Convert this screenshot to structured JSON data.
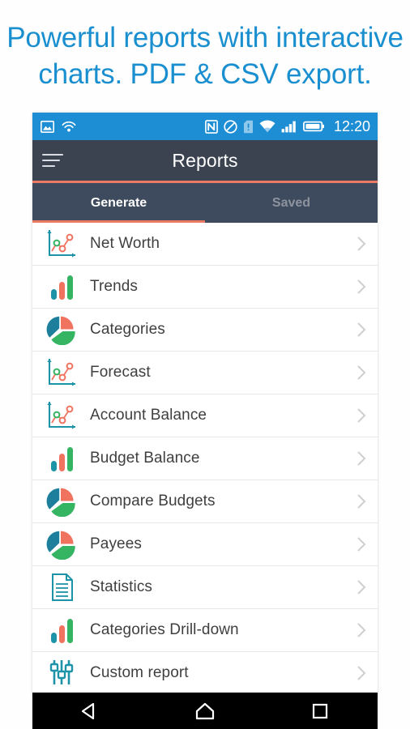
{
  "headline": {
    "line1": "Powerful reports with interactive",
    "line2": "charts. PDF & CSV export."
  },
  "colors": {
    "headline": "#1a8fd0",
    "status_bar": "#1e8ed4",
    "toolbar": "#3b4350",
    "tabbar": "#3e4a5e",
    "accent": "#ec7a64",
    "teal": "#1d93a8",
    "salmon": "#f07360",
    "green": "#35b462",
    "label": "#3f3f3f",
    "chevron": "#cfcfcf",
    "navbar": "#000000"
  },
  "status_bar": {
    "left_icons": [
      "image-icon",
      "cast-wifi-icon"
    ],
    "right_icons": [
      "nfc-icon",
      "do-not-disturb-icon",
      "sim-alert-icon",
      "wifi-icon",
      "signal-icon",
      "battery-icon"
    ],
    "clock": "12:20"
  },
  "toolbar": {
    "menu_icon": "hamburger-menu-icon",
    "title": "Reports"
  },
  "tabs": [
    {
      "label": "Generate",
      "active": true
    },
    {
      "label": "Saved",
      "active": false
    }
  ],
  "list": {
    "items": [
      {
        "label": "Net Worth",
        "icon": "line-chart-icon",
        "chevron": "chevron-right-icon"
      },
      {
        "label": "Trends",
        "icon": "bar-chart-icon",
        "chevron": "chevron-right-icon"
      },
      {
        "label": "Categories",
        "icon": "pie-chart-icon",
        "chevron": "chevron-right-icon"
      },
      {
        "label": "Forecast",
        "icon": "line-chart-icon",
        "chevron": "chevron-right-icon"
      },
      {
        "label": "Account Balance",
        "icon": "line-chart-icon",
        "chevron": "chevron-right-icon"
      },
      {
        "label": "Budget Balance",
        "icon": "bar-chart-icon",
        "chevron": "chevron-right-icon"
      },
      {
        "label": "Compare Budgets",
        "icon": "pie-chart-icon",
        "chevron": "chevron-right-icon"
      },
      {
        "label": "Payees",
        "icon": "pie-chart-icon",
        "chevron": "chevron-right-icon"
      },
      {
        "label": "Statistics",
        "icon": "document-icon",
        "chevron": "chevron-right-icon"
      },
      {
        "label": "Categories Drill-down",
        "icon": "bar-chart-icon",
        "chevron": "chevron-right-icon"
      },
      {
        "label": "Custom report",
        "icon": "sliders-icon",
        "chevron": "chevron-right-icon"
      }
    ]
  },
  "navbar": {
    "back": "back-triangle-icon",
    "home": "home-pentagon-icon",
    "recents": "recents-square-icon"
  }
}
